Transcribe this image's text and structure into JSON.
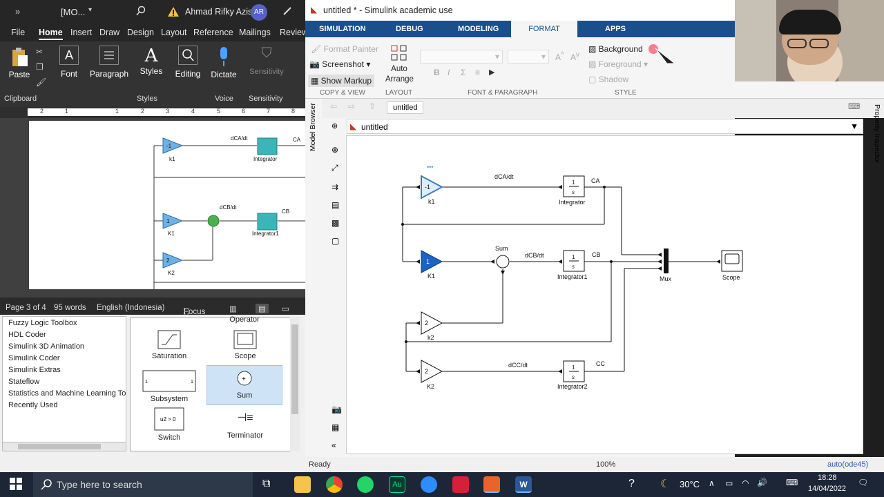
{
  "word": {
    "title_doc": "[MO...",
    "user_name": "Ahmad Rifky Azis",
    "user_initials": "AR",
    "tabs": [
      "File",
      "Home",
      "Insert",
      "Draw",
      "Design",
      "Layout",
      "References",
      "Mailings",
      "Review"
    ],
    "tools": {
      "paste": "Paste",
      "font": "Font",
      "paragraph": "Paragraph",
      "styles": "Styles",
      "editing": "Editing",
      "dictate": "Dictate",
      "sensitivity": "Sensitivity"
    },
    "groups": {
      "clipboard": "Clipboard",
      "styles": "Styles",
      "voice": "Voice",
      "sensitivity": "Sensitivity"
    },
    "ruler_numbers": [
      "2",
      "1",
      "1",
      "2",
      "3",
      "4",
      "5",
      "6",
      "7",
      "8"
    ],
    "doc_labels": {
      "dCA": "dCA/dt",
      "CA": "CA",
      "k1": "k1",
      "integrator": "Integrator",
      "dCB": "dCB/dt",
      "CB": "CB",
      "K1": "K1",
      "integrator1": "Integrator1",
      "K2": "K2",
      "gain_neg1": "-1",
      "gain_1": "1",
      "gain_2": "2"
    },
    "status": {
      "page": "Page 3 of 4",
      "words": "95 words",
      "language": "English (Indonesia)",
      "focus": "Focus"
    }
  },
  "library": {
    "list": [
      "Fuzzy Logic Toolbox",
      "HDL Coder",
      "Simulink 3D Animation",
      "Simulink Coder",
      "Simulink Extras",
      "Stateflow",
      "Statistics and Machine Learning To",
      "Recently Used"
    ],
    "blocks": [
      "Operator",
      "Saturation",
      "Scope",
      "Subsystem",
      "Sum",
      "Switch",
      "Terminator"
    ]
  },
  "simulink": {
    "title": "untitled * - Simulink academic use",
    "tabs": [
      "SIMULATION",
      "DEBUG",
      "MODELING",
      "FORMAT",
      "APPS"
    ],
    "active_tab": "FORMAT",
    "ribbon": {
      "format_painter": "Format Painter",
      "screenshot": "Screenshot",
      "show_markup": "Show Markup",
      "auto_arrange": "Auto Arrange",
      "background": "Background",
      "foreground": "Foreground",
      "shadow": "Shadow"
    },
    "ribbon_groups": {
      "copy_view": "COPY & VIEW",
      "layout": "LAYOUT",
      "font_para": "FONT & PARAGRAPH",
      "style": "STYLE"
    },
    "model_tab": "untitled",
    "breadcrumb": "untitled",
    "side_left": "Model Browser",
    "side_right": "Property Inspector",
    "status": {
      "ready": "Ready",
      "zoom": "100%",
      "solver": "auto(ode45)"
    },
    "diagram": {
      "k1_gain": "-1",
      "k1_label": "k1",
      "dCA": "dCA/dt",
      "int_label": "Integrator",
      "CA": "CA",
      "int_num": "1",
      "int_den": "s",
      "K1_gain": "1",
      "K1_label": "K1",
      "sum_label": "Sum",
      "dCB": "dCB/dt",
      "int1_label": "Integrator1",
      "CB": "CB",
      "k2_gain": "2",
      "k2_label": "k2",
      "K2_gain": "2",
      "K2_label": "K2",
      "dCC": "dCC/dt",
      "int2_label": "Integrator2",
      "CC": "CC",
      "mux_label": "Mux",
      "scope_label": "Scope",
      "dots": "•••"
    }
  },
  "taskbar": {
    "search_placeholder": "Type here to search",
    "temp": "30°C",
    "time": "18:28",
    "date": "14/04/2022"
  }
}
